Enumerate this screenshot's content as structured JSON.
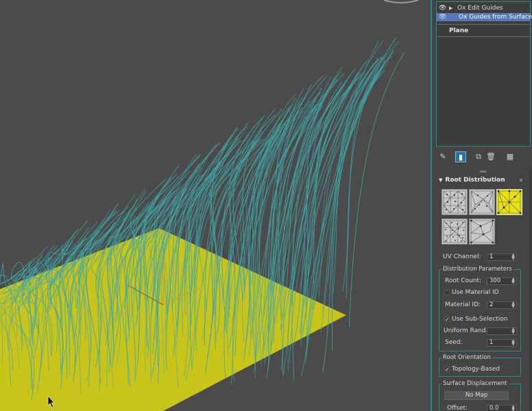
{
  "modifier_stack": {
    "items": [
      {
        "label": "Ox Edit Guides",
        "selected": false
      },
      {
        "label": "Ox Guides from Surface",
        "selected": true
      }
    ],
    "base_object": "Plane"
  },
  "toolbar": {
    "icons": [
      "pin-stack-icon",
      "show-end-result-icon",
      "make-unique-icon",
      "remove-modifier-icon",
      "configure-modifier-sets-icon"
    ]
  },
  "root_distribution": {
    "title": "Root Distribution",
    "uv_channel_label": "UV Channel:",
    "uv_channel_value": "1",
    "selected_method_index": 2
  },
  "distribution_parameters": {
    "title": "Distribution Parameters",
    "root_count_label": "Root Count:",
    "root_count_value": "300",
    "use_material_id_label": "Use Material ID",
    "use_material_id_checked": false,
    "material_id_label": "Material ID:",
    "material_id_value": "2",
    "use_sub_selection_label": "Use Sub-Selection",
    "use_sub_selection_checked": true,
    "uniform_rand_label": "Uniform Rand.:",
    "uniform_rand_value": "",
    "seed_label": "Seed:",
    "seed_value": "1"
  },
  "root_orientation": {
    "title": "Root Orientation",
    "topology_based_label": "Topology-Based",
    "topology_based_checked": true
  },
  "surface_displacement": {
    "title": "Surface Displacement",
    "map_button_label": "No Map",
    "offset_label": "Offset:",
    "offset_value": "0.0"
  },
  "colors": {
    "viewport_bg": "#4b4b4b",
    "guide_color": "#3fa6a8",
    "plane_color": "#c9c419",
    "accent": "#2a8a8e",
    "selection": "#5578b8"
  }
}
